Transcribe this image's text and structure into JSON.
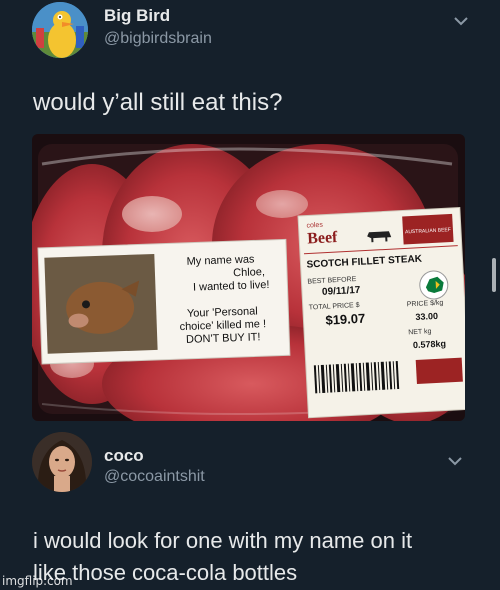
{
  "tweet1": {
    "display_name": "Big Bird",
    "handle": "@bigbirdsbrain",
    "text": "would y’all still eat this?",
    "avatar_icon": "big-bird-avatar",
    "photo": {
      "sticker": {
        "line1": "My name was",
        "line2": "Chloe,",
        "line3": "I wanted to live!",
        "line4": "Your 'Personal",
        "line5": "choice' killed me !",
        "line6": "DON'T BUY IT!"
      },
      "label": {
        "brand_small": "coles",
        "brand": "Beef",
        "product": "SCOTCH FILLET STEAK",
        "best_before_label": "BEST BEFORE",
        "best_before": "09/11/17",
        "total_price_label": "TOTAL PRICE $",
        "total_price": "$19.07",
        "price_kg_label": "PRICE $/kg",
        "price_kg": "33.00",
        "net_label": "NET kg",
        "net": "0.578kg",
        "badge": "AUSTRALIAN BEEF"
      }
    }
  },
  "tweet2": {
    "display_name": "coco",
    "handle": "@cocoaintshit",
    "text_line1": "i would look for one with my name on it",
    "text_line2": "like those coca-cola bottles",
    "avatar_icon": "coco-avatar"
  },
  "watermark": "imgflip.com",
  "colors": {
    "background": "#15202b",
    "text": "#e7e9ea",
    "secondary": "#8b98a5",
    "beef_red": "#b8323a"
  }
}
